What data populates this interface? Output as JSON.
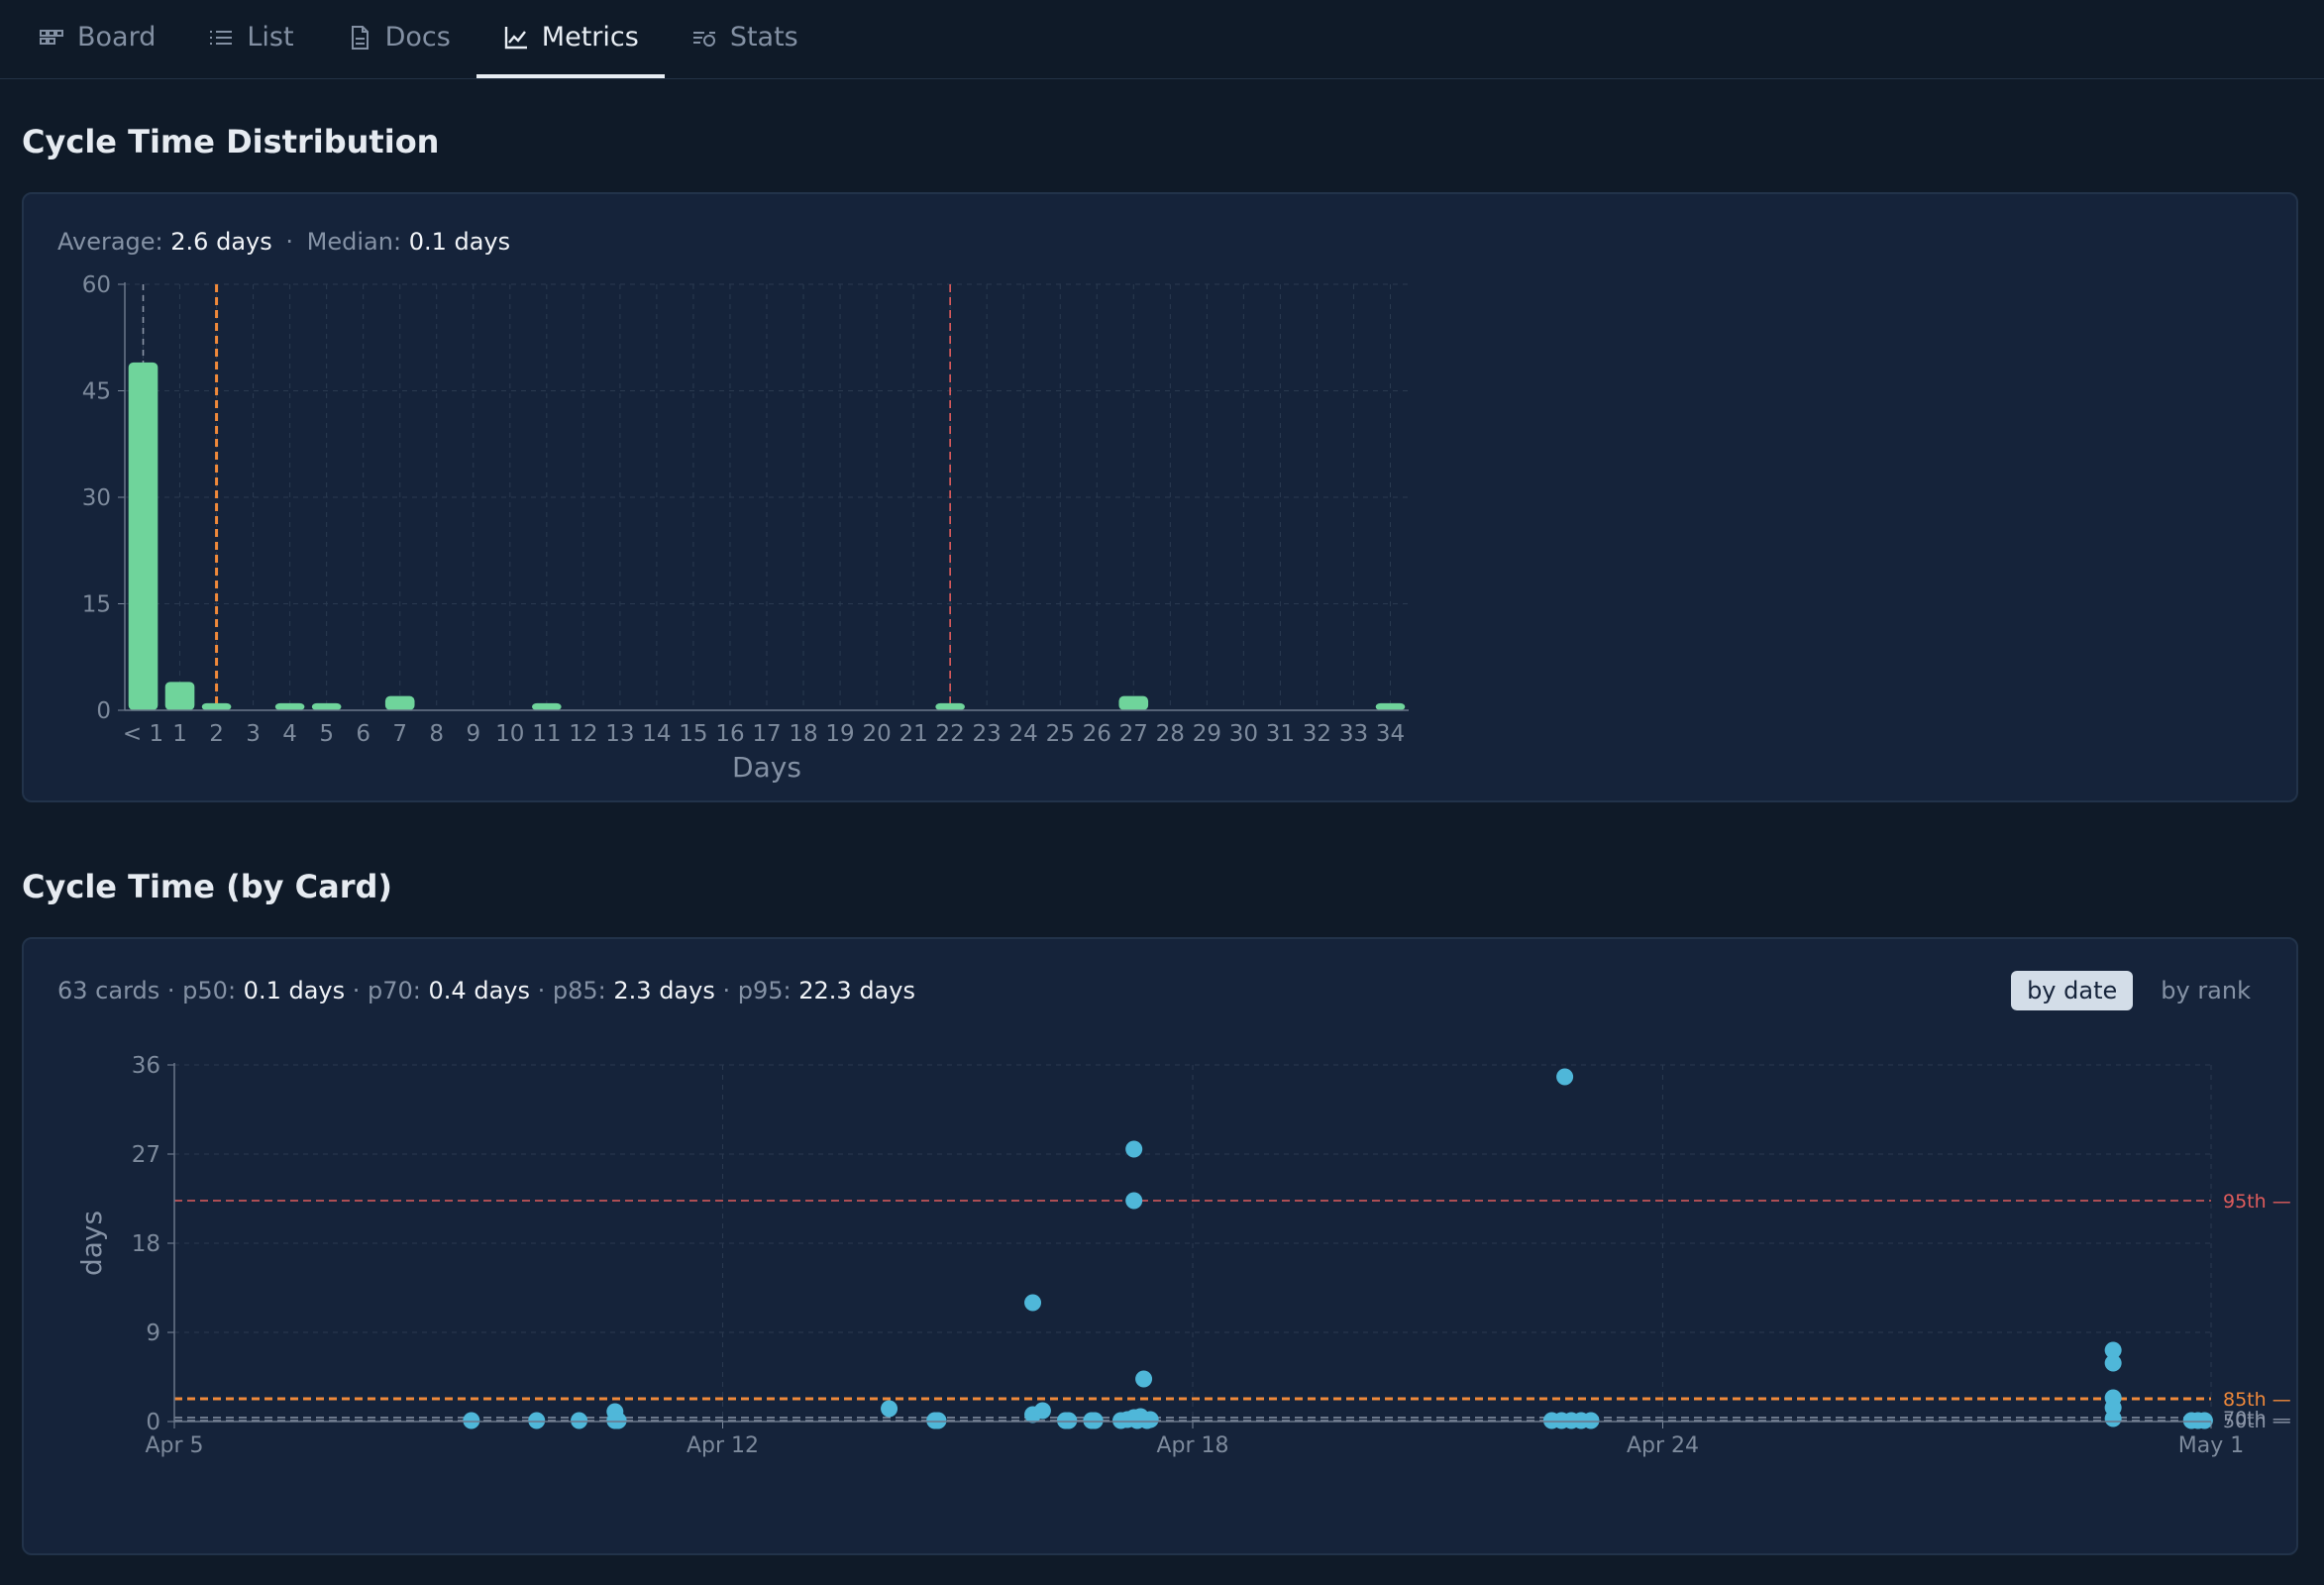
{
  "tabs": [
    {
      "label": "Board",
      "icon": "board-icon",
      "active": false
    },
    {
      "label": "List",
      "icon": "list-icon",
      "active": false
    },
    {
      "label": "Docs",
      "icon": "doc-icon",
      "active": false
    },
    {
      "label": "Metrics",
      "icon": "chart-line-icon",
      "active": true
    },
    {
      "label": "Stats",
      "icon": "stats-icon",
      "active": false
    }
  ],
  "distribution": {
    "title": "Cycle Time Distribution",
    "avg_label": "Average:",
    "avg_value": "2.6 days",
    "sep": "·",
    "median_label": "Median:",
    "median_value": "0.1 days"
  },
  "by_card": {
    "title": "Cycle Time (by Card)",
    "count": "63 cards",
    "p50_label": "p50:",
    "p50_value": "0.1 days",
    "p70_label": "p70:",
    "p70_value": "0.4 days",
    "p85_label": "p85:",
    "p85_value": "2.3 days",
    "p95_label": "p95:",
    "p95_value": "22.3 days",
    "toggle_by_date": "by date",
    "toggle_by_rank": "by rank"
  },
  "colors": {
    "bar": "#6fd49b",
    "dot": "#4fb7d9",
    "p85": "#f0893a",
    "p95": "#e05c5c",
    "median": "#8a94a6"
  },
  "chart_data": [
    {
      "type": "bar",
      "categories": [
        "< 1",
        "1",
        "2",
        "3",
        "4",
        "5",
        "6",
        "7",
        "8",
        "9",
        "10",
        "11",
        "12",
        "13",
        "14",
        "15",
        "16",
        "17",
        "18",
        "19",
        "20",
        "21",
        "22",
        "23",
        "24",
        "25",
        "26",
        "27",
        "28",
        "29",
        "30",
        "31",
        "32",
        "33",
        "34"
      ],
      "values": [
        49,
        4,
        1,
        0,
        1,
        1,
        0,
        2,
        0,
        0,
        0,
        1,
        0,
        0,
        0,
        0,
        0,
        0,
        0,
        0,
        0,
        0,
        1,
        0,
        0,
        0,
        0,
        2,
        0,
        0,
        0,
        0,
        0,
        0,
        1
      ],
      "xlabel": "Days",
      "ylim": [
        0,
        60
      ],
      "yticks": [
        0,
        15,
        30,
        45,
        60
      ],
      "reference_lines": [
        {
          "x": 0.1,
          "style": "median"
        },
        {
          "x": 2,
          "style": "p85"
        },
        {
          "x": 22,
          "style": "p95"
        }
      ],
      "grid": true
    },
    {
      "type": "scatter",
      "ylabel": "days",
      "ylim": [
        0,
        36
      ],
      "yticks": [
        0,
        9,
        18,
        27,
        36
      ],
      "x_tick_labels": [
        "Apr 5",
        "Apr 12",
        "Apr 18",
        "Apr 24",
        "May 1"
      ],
      "x_tick_dates": [
        "2024-04-05",
        "2024-04-12",
        "2024-04-18",
        "2024-04-24",
        "2024-05-01"
      ],
      "xlim": [
        "2024-04-05",
        "2024-05-01"
      ],
      "reference_lines": [
        {
          "label": "95th —",
          "y": 22.3,
          "style": "p95"
        },
        {
          "label": "85th —",
          "y": 2.3,
          "style": "p85"
        },
        {
          "label": "70th —",
          "y": 0.4,
          "style": "median"
        },
        {
          "label": "50th —",
          "y": 0.1,
          "style": "median"
        }
      ],
      "points": [
        {
          "x": "2024-04-08 19:00",
          "y": 0.1
        },
        {
          "x": "2024-04-09 15:00",
          "y": 0.1
        },
        {
          "x": "2024-04-10 04:00",
          "y": 0.1
        },
        {
          "x": "2024-04-10 15:00",
          "y": 1.0
        },
        {
          "x": "2024-04-10 15:00",
          "y": 0.1
        },
        {
          "x": "2024-04-10 16:00",
          "y": 0.1
        },
        {
          "x": "2024-04-14 03:00",
          "y": 1.3
        },
        {
          "x": "2024-04-14 17:00",
          "y": 0.1
        },
        {
          "x": "2024-04-14 18:00",
          "y": 0.1
        },
        {
          "x": "2024-04-15 23:00",
          "y": 12.0
        },
        {
          "x": "2024-04-15 23:00",
          "y": 0.7
        },
        {
          "x": "2024-04-16 02:00",
          "y": 1.1
        },
        {
          "x": "2024-04-16 09:00",
          "y": 0.1
        },
        {
          "x": "2024-04-16 10:00",
          "y": 0.1
        },
        {
          "x": "2024-04-16 17:00",
          "y": 0.1
        },
        {
          "x": "2024-04-16 18:00",
          "y": 0.1
        },
        {
          "x": "2024-04-17 02:00",
          "y": 0.1
        },
        {
          "x": "2024-04-17 04:00",
          "y": 0.2
        },
        {
          "x": "2024-04-17 06:00",
          "y": 27.5
        },
        {
          "x": "2024-04-17 06:00",
          "y": 22.3
        },
        {
          "x": "2024-04-17 06:00",
          "y": 0.4
        },
        {
          "x": "2024-04-17 07:00",
          "y": 0.1
        },
        {
          "x": "2024-04-17 08:00",
          "y": 0.5
        },
        {
          "x": "2024-04-17 09:00",
          "y": 4.3
        },
        {
          "x": "2024-04-17 10:00",
          "y": 0.1
        },
        {
          "x": "2024-04-17 11:00",
          "y": 0.2
        },
        {
          "x": "2024-04-22 18:00",
          "y": 34.8
        },
        {
          "x": "2024-04-22 14:00",
          "y": 0.1
        },
        {
          "x": "2024-04-22 17:00",
          "y": 0.1
        },
        {
          "x": "2024-04-22 20:00",
          "y": 0.1
        },
        {
          "x": "2024-04-22 23:00",
          "y": 0.1
        },
        {
          "x": "2024-04-23 02:00",
          "y": 0.1
        },
        {
          "x": "2024-04-29 18:00",
          "y": 7.2
        },
        {
          "x": "2024-04-29 18:00",
          "y": 5.9
        },
        {
          "x": "2024-04-29 18:00",
          "y": 2.4
        },
        {
          "x": "2024-04-29 18:00",
          "y": 1.4
        },
        {
          "x": "2024-04-29 18:00",
          "y": 0.3
        },
        {
          "x": "2024-04-30 18:00",
          "y": 0.1
        },
        {
          "x": "2024-04-30 20:00",
          "y": 0.1
        },
        {
          "x": "2024-04-30 22:00",
          "y": 0.1
        }
      ],
      "grid": true
    }
  ]
}
